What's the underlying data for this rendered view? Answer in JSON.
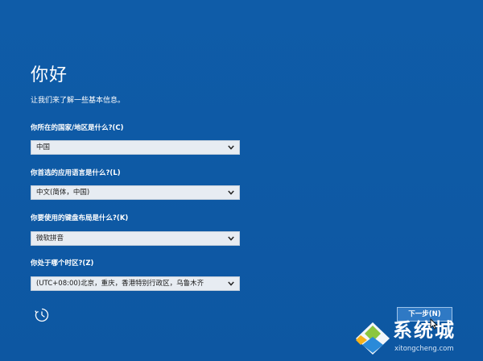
{
  "setup": {
    "title": "你好",
    "subtitle": "让我们来了解一些基本信息。",
    "fields": [
      {
        "label": "你所在的国家/地区是什么?(C)",
        "value": "中国"
      },
      {
        "label": "你首选的应用语言是什么?(L)",
        "value": "中文(简体，中国)"
      },
      {
        "label": "你要使用的键盘布局是什么?(K)",
        "value": "微软拼音"
      },
      {
        "label": "你处于哪个时区?(Z)",
        "value": "(UTC+08:00)北京，重庆，香港特别行政区，乌鲁木齐"
      }
    ],
    "next_label": "下一步(N)",
    "accessibility_icon": "accessibility-icon"
  },
  "watermark": {
    "main": "系统城",
    "sub": "xitongcheng.com"
  },
  "colors": {
    "background": "#0e5aa6",
    "select_bg": "#e7ecf2",
    "button_bg": "#2f79c4"
  }
}
